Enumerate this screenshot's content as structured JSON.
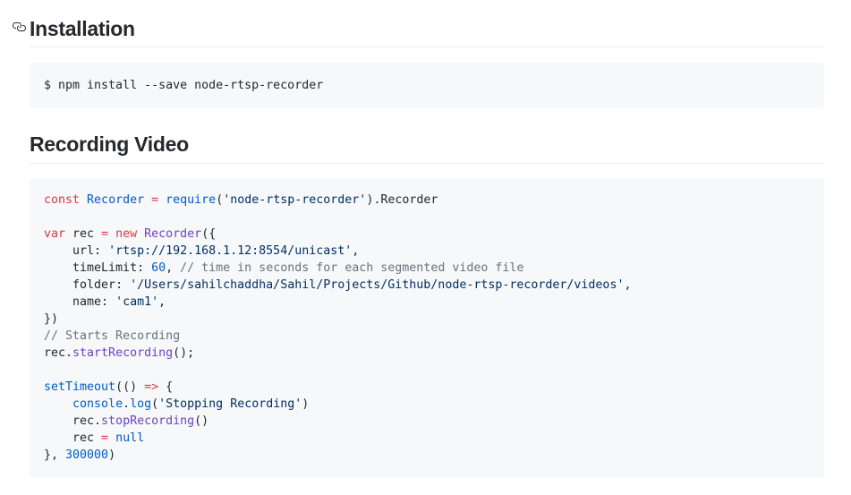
{
  "sections": {
    "installation": {
      "title": "Installation"
    },
    "recording": {
      "title": "Recording Video"
    }
  },
  "install_code": {
    "line": "$ npm install --save node-rtsp-recorder"
  },
  "code": {
    "l1": [
      "const",
      " ",
      "Recorder",
      " ",
      "=",
      " ",
      "require",
      "(",
      "'node-rtsp-recorder'",
      ").Recorder"
    ],
    "l3": [
      "var",
      " rec ",
      "=",
      " ",
      "new",
      " ",
      "Recorder",
      "({"
    ],
    "l4": [
      "    url",
      ": ",
      "'rtsp://192.168.1.12:8554/unicast'",
      ","
    ],
    "l5": [
      "    timeLimit",
      ": ",
      "60",
      ", ",
      "// time in seconds for each segmented video file"
    ],
    "l6": [
      "    folder",
      ": ",
      "'/Users/sahilchaddha/Sahil/Projects/Github/node-rtsp-recorder/videos'",
      ","
    ],
    "l7": [
      "    name",
      ": ",
      "'cam1'",
      ","
    ],
    "l8": [
      "})"
    ],
    "l9": [
      "// Starts Recording"
    ],
    "l10": [
      "rec.",
      "startRecording",
      "();"
    ],
    "l12": [
      "setTimeout",
      "(() ",
      "=>",
      " {"
    ],
    "l13": [
      "    ",
      "console",
      ".",
      "log",
      "(",
      "'Stopping Recording'",
      ")"
    ],
    "l14": [
      "    rec.",
      "stopRecording",
      "()"
    ],
    "l15": [
      "    rec ",
      "=",
      " ",
      "null"
    ],
    "l16": [
      "}, ",
      "300000",
      ")"
    ]
  },
  "colors": {
    "keyword": "#d73a49",
    "entity": "#005cc5",
    "function": "#6f42c1",
    "string": "#032f62",
    "comment": "#6a737d",
    "text": "#24292e",
    "code_bg": "#f6f8fa"
  },
  "icons": {
    "heading_anchor": "link-icon"
  }
}
